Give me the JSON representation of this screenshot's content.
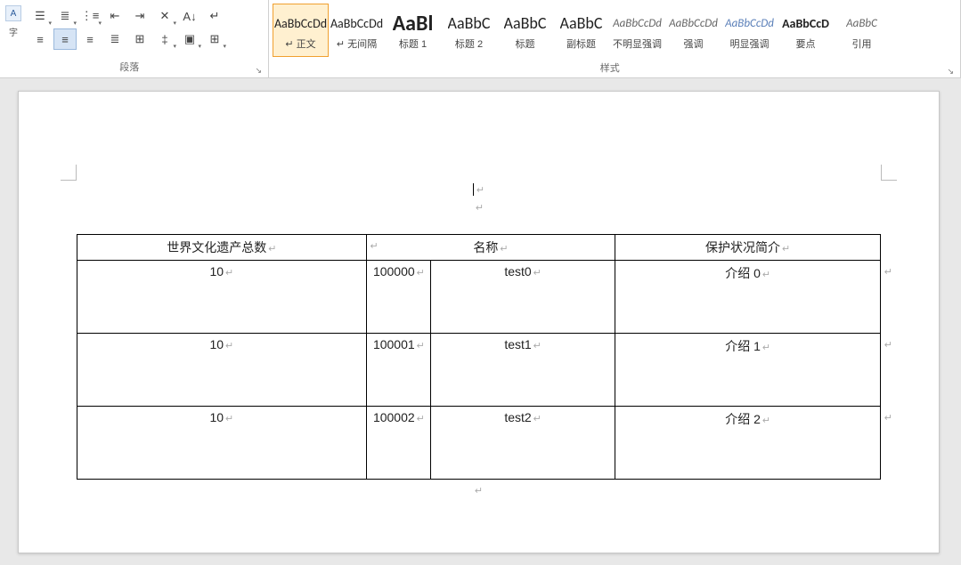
{
  "ribbon": {
    "paragraph_label": "段落",
    "styles_label": "样式",
    "side_a": "A",
    "side_b": "字"
  },
  "styles": [
    {
      "preview": "AaBbCcDd",
      "name": "↵ 正文",
      "cls": "sp-normal",
      "selected": true
    },
    {
      "preview": "AaBbCcDd",
      "name": "↵ 无间隔",
      "cls": "sp-normal"
    },
    {
      "preview": "AaBl",
      "name": "标题 1",
      "cls": "sp-big"
    },
    {
      "preview": "AaBbC",
      "name": "标题 2",
      "cls": "sp-med"
    },
    {
      "preview": "AaBbC",
      "name": "标题",
      "cls": "sp-med"
    },
    {
      "preview": "AaBbC",
      "name": "副标题",
      "cls": "sp-med"
    },
    {
      "preview": "AaBbCcDd",
      "name": "不明显强调",
      "cls": "sp-italic"
    },
    {
      "preview": "AaBbCcDd",
      "name": "强调",
      "cls": "sp-italic"
    },
    {
      "preview": "AaBbCcDd",
      "name": "明显强调",
      "cls": "sp-ital-blue"
    },
    {
      "preview": "AaBbCcD",
      "name": "要点",
      "cls": "sp-bold"
    },
    {
      "preview": "AaBbC",
      "name": "引用",
      "cls": "sp-italic"
    }
  ],
  "document": {
    "headers": [
      "世界文化遗产总数",
      "名称",
      "保护状况简介"
    ],
    "rows": [
      {
        "total": "10",
        "id": "100000",
        "name": "test0",
        "desc": "介绍 0"
      },
      {
        "total": "10",
        "id": "100001",
        "name": "test1",
        "desc": "介绍 1"
      },
      {
        "total": "10",
        "id": "100002",
        "name": "test2",
        "desc": "介绍 2"
      }
    ]
  }
}
